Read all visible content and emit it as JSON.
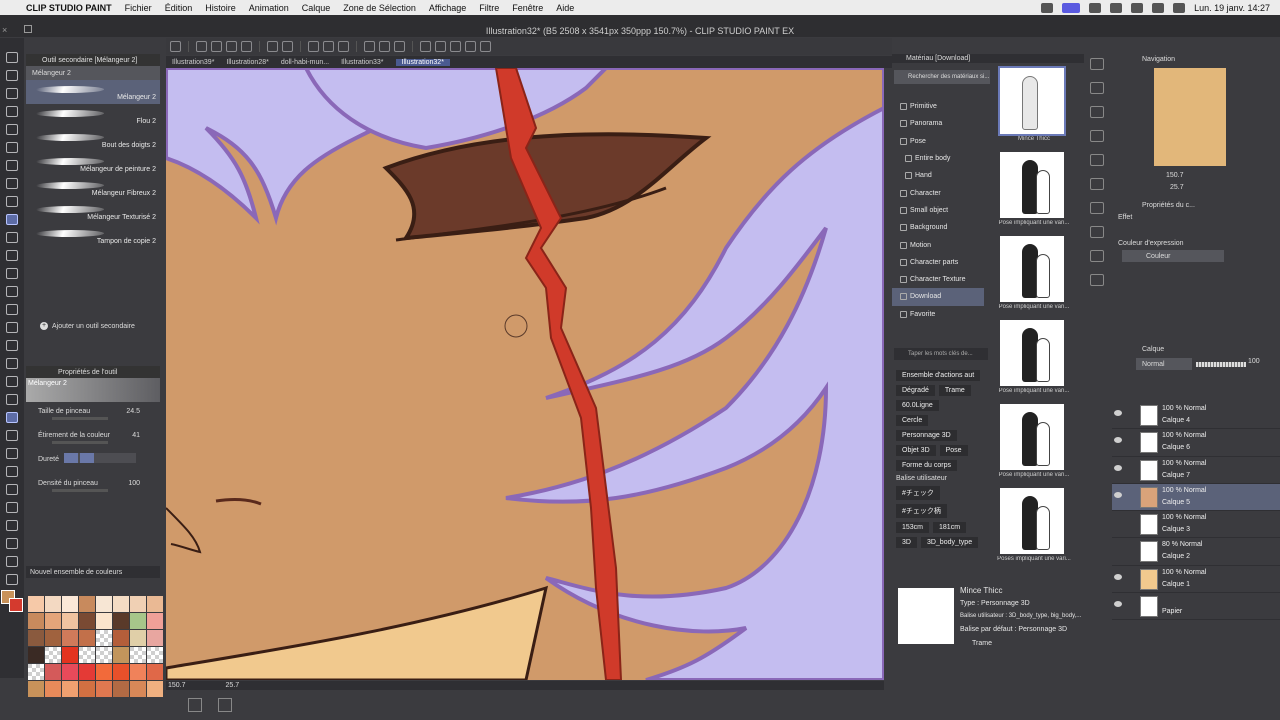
{
  "menubar": {
    "app_name": "CLIP STUDIO PAINT",
    "menus": [
      "Fichier",
      "Édition",
      "Histoire",
      "Animation",
      "Calque",
      "Zone de Sélection",
      "Affichage",
      "Filtre",
      "Fenêtre",
      "Aide"
    ],
    "clock": "Lun. 19 janv.  14:27"
  },
  "window": {
    "title": "Illustration32* (B5 2508 x 3541px 350ppp 150.7%) - CLIP STUDIO PAINT EX"
  },
  "doc_tabs": [
    "Illustration39*",
    "Illustration28*",
    "doll-habi-mun...",
    "Illustration33*",
    "Illustration32*"
  ],
  "subtool": {
    "header": "Outil secondaire [Mélangeur 2]",
    "tab": "Mélangeur 2",
    "items": [
      "Mélangeur 2",
      "Flou 2",
      "Bout des doigts 2",
      "Mélangeur de peinture 2",
      "Mélangeur Fibreux 2",
      "Mélangeur Texturisé 2",
      "Tampon de copie 2"
    ],
    "add_label": "Ajouter un outil secondaire"
  },
  "tool_property": {
    "header": "Propriétés de l'outil",
    "preview_label": "Mélangeur 2",
    "props": [
      {
        "label": "Taille de pinceau",
        "value": "24.5"
      },
      {
        "label": "Étirement de la couleur",
        "value": "41"
      },
      {
        "label": "Dureté",
        "value": ""
      },
      {
        "label": "Densité du pinceau",
        "value": "100"
      }
    ]
  },
  "color_set": {
    "header": "Nouvel ensemble de couleurs",
    "colors": [
      "#f6c9a8",
      "#f3d9c2",
      "#fbe8d8",
      "#c88a5d",
      "#f7e6d4",
      "#f4dcc4",
      "#f0d0b4",
      "#eab994",
      "#c88a5d",
      "#e4a57a",
      "#f0c3a0",
      "#7a4a33",
      "#fbe4cc",
      "#5a3a2a",
      "#a7c68a",
      "#f0a098",
      "#8a5a3e",
      "#a0623e",
      "#d07a5a",
      "#c2704a",
      "chk",
      "#b45e3a",
      "#e0cfa8",
      "#e8a6a0",
      "#3a2a24",
      "chk",
      "#e4331f",
      "chk",
      "chk",
      "#c2955c",
      "chk",
      "chk",
      "chk",
      "#d45a5a",
      "#e84a5a",
      "#e43a36",
      "#f26a3a",
      "#e8502a",
      "#f0825a",
      "#e06848",
      "#c8925a",
      "#e88a5a",
      "#f0a070",
      "#d27042",
      "#e07850",
      "#b26a44",
      "#d88858",
      "#f0b080"
    ]
  },
  "canvas_status": {
    "zoom": "150.7",
    "angle": "25.7"
  },
  "material": {
    "header": "Matériau [Download]",
    "search_placeholder": "Rechercher des matériaux si...",
    "tree": [
      {
        "label": "Primitive",
        "sub": false
      },
      {
        "label": "Panorama",
        "sub": false
      },
      {
        "label": "Pose",
        "sub": false
      },
      {
        "label": "Entire body",
        "sub": true
      },
      {
        "label": "Hand",
        "sub": true
      },
      {
        "label": "Character",
        "sub": false
      },
      {
        "label": "Small object",
        "sub": false
      },
      {
        "label": "Background",
        "sub": false
      },
      {
        "label": "Motion",
        "sub": false
      },
      {
        "label": "Character parts",
        "sub": false
      },
      {
        "label": "Character Texture",
        "sub": false
      },
      {
        "label": "Download",
        "sub": false,
        "selected": true
      },
      {
        "label": "Favorite",
        "sub": false
      }
    ],
    "tag_search_placeholder": "Taper les mots clés de...",
    "tags": [
      [
        "Ensemble d'actions aut"
      ],
      [
        "Dégradé",
        "Trame"
      ],
      [
        "60.0Ligne"
      ],
      [
        "Cercle"
      ],
      [
        "Personnage 3D"
      ],
      [
        "Objet 3D",
        "Pose"
      ],
      [
        "Forme du corps"
      ]
    ],
    "user_tags_label": "Balise utilisateur",
    "user_tags": [
      [
        "#チェック"
      ],
      [
        "#チェック柄"
      ],
      [
        "153cm",
        "181cm"
      ],
      [
        "3D",
        "3D_body_type"
      ]
    ],
    "thumbs": [
      "Mince Thicc",
      "Pose impliquant une vari...",
      "Pose impliquant une vari...",
      "Pose impliquant une vari...",
      "Pose impliquant une vari...",
      "Poses impliquant une vari..."
    ],
    "info": {
      "name": "Mince Thicc",
      "type": "Type : Personnage 3D",
      "user_tag": "Balise utilisateur : 3D_body_type, big_body,...",
      "default_tag": "Balise par défaut : Personnage 3D",
      "check": "Trame"
    }
  },
  "navigation": {
    "header": "Navigation",
    "zoom": "150.7",
    "angle": "25.7"
  },
  "layer_property": {
    "header": "Propriétés du c...",
    "effect_label": "Effet",
    "expression_label": "Couleur d'expression",
    "expression_value": "Couleur"
  },
  "layers": {
    "header": "Calque",
    "blend": "Normal",
    "opacity": "100",
    "items": [
      {
        "mode": "100 % Normal",
        "name": "Calque 4",
        "visible": true,
        "color": "#ffffff"
      },
      {
        "mode": "100 % Normal",
        "name": "Calque 6",
        "visible": true,
        "color": "#ffffff"
      },
      {
        "mode": "100 % Normal",
        "name": "Calque 7",
        "visible": true,
        "color": "#ffffff"
      },
      {
        "mode": "100 % Normal",
        "name": "Calque 5",
        "visible": true,
        "color": "#d9a37a",
        "selected": true
      },
      {
        "mode": "100 % Normal",
        "name": "Calque 3",
        "visible": false,
        "color": "#ffffff"
      },
      {
        "mode": "80 % Normal",
        "name": "Calque 2",
        "visible": false,
        "color": "#ffffff"
      },
      {
        "mode": "100 % Normal",
        "name": "Calque 1",
        "visible": true,
        "color": "#f1c98e"
      },
      {
        "mode": "",
        "name": "Papier",
        "visible": true,
        "color": "#ffffff"
      }
    ]
  },
  "colors": {
    "accent": "#5b6279",
    "skin": "#d09a6a",
    "hair": "#c4bdf0",
    "hair_line": "#8a68b8",
    "blood": "#d03a2a"
  }
}
